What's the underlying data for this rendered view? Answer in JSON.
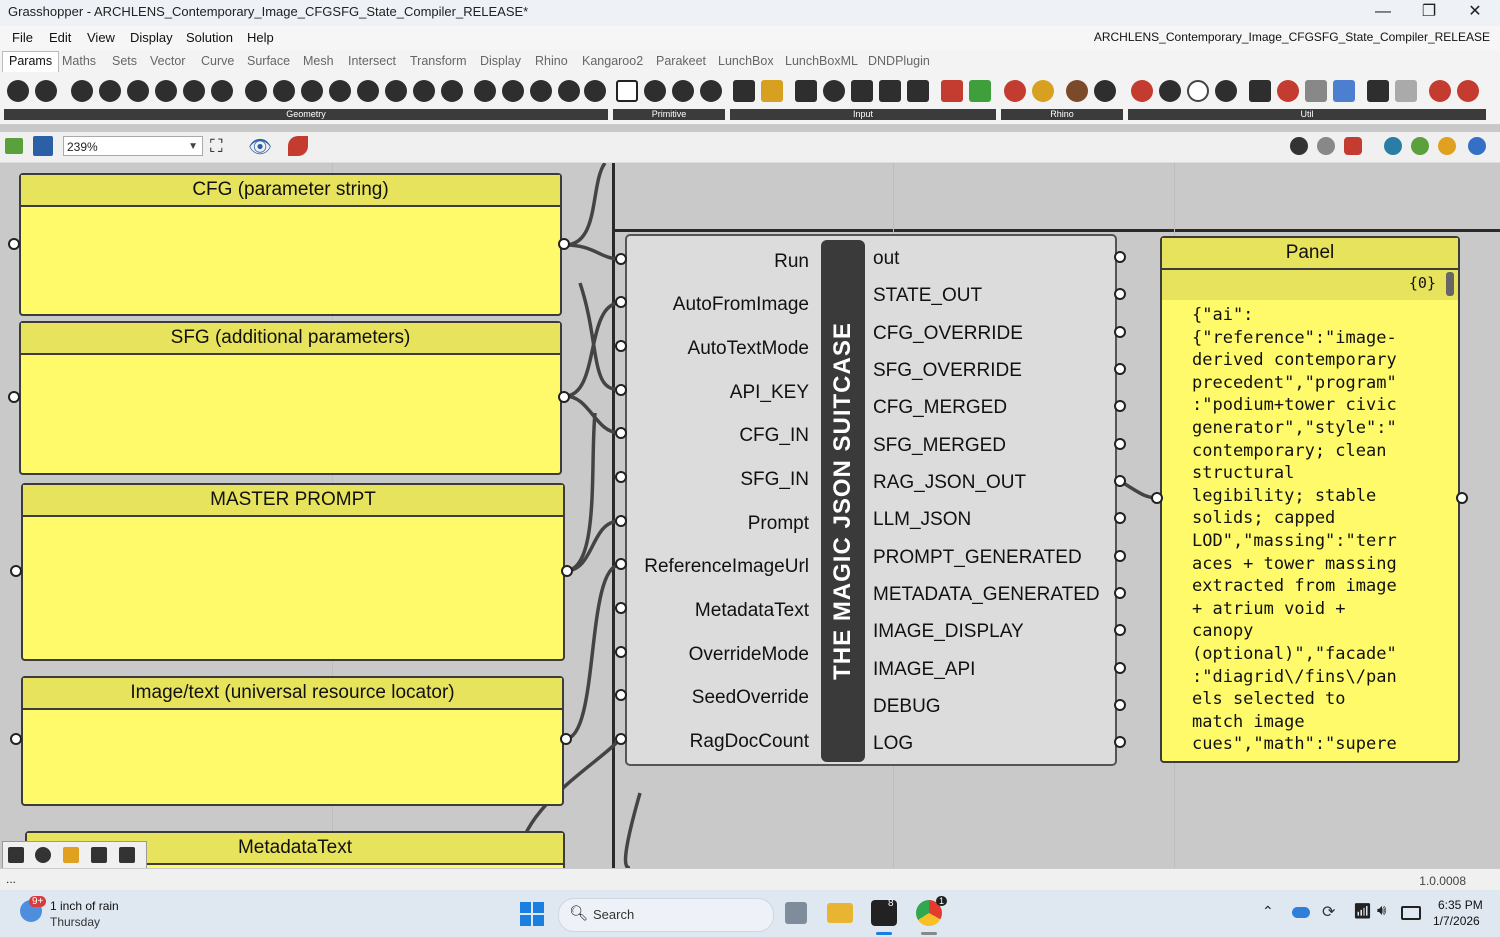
{
  "window": {
    "title": "Grasshopper - ARCHLENS_Contemporary_Image_CFGSFG_State_Compiler_RELEASE*",
    "minimize": "—",
    "maximize": "❐",
    "close": "✕"
  },
  "menu": {
    "items": [
      "File",
      "Edit",
      "View",
      "Display",
      "Solution",
      "Help"
    ],
    "document_name": "ARCHLENS_Contemporary_Image_CFGSFG_State_Compiler_RELEASE"
  },
  "tabs": [
    "Params",
    "Maths",
    "Sets",
    "Vector",
    "Curve",
    "Surface",
    "Mesh",
    "Intersect",
    "Transform",
    "Display",
    "Rhino",
    "Kangaroo2",
    "Parakeet",
    "LunchBox",
    "LunchBoxML",
    "DNDPlugin"
  ],
  "ribbon": {
    "groups": [
      "Geometry",
      "Primitive",
      "Input",
      "Rhino",
      "Util"
    ]
  },
  "canvas_toolbar": {
    "zoom": "239%"
  },
  "panels": {
    "cfg": "CFG (parameter string)",
    "sfg": "SFG (additional parameters)",
    "master": "MASTER PROMPT",
    "image_url": "Image/text (universal resource locator)",
    "metadata": "MetadataText"
  },
  "component": {
    "name": "THE MAGIC JSON SUITCASE",
    "inputs": [
      "Run",
      "AutoFromImage",
      "AutoTextMode",
      "API_KEY",
      "CFG_IN",
      "SFG_IN",
      "Prompt",
      "ReferenceImageUrl",
      "MetadataText",
      "OverrideMode",
      "SeedOverride",
      "RagDocCount"
    ],
    "outputs": [
      "out",
      "STATE_OUT",
      "CFG_OVERRIDE",
      "SFG_OVERRIDE",
      "CFG_MERGED",
      "SFG_MERGED",
      "RAG_JSON_OUT",
      "LLM_JSON",
      "PROMPT_GENERATED",
      "METADATA_GENERATED",
      "IMAGE_DISPLAY",
      "IMAGE_API",
      "DEBUG",
      "LOG"
    ]
  },
  "output_panel": {
    "title": "Panel",
    "path": "{0}",
    "content": "{\"ai\":\n{\"reference\":\"image-\nderived contemporary\nprecedent\",\"program\"\n:\"podium+tower civic\ngenerator\",\"style\":\"\ncontemporary; clean\nstructural\nlegibility; stable\nsolids; capped\nLOD\",\"massing\":\"terr\naces + tower massing\nextracted from image\n+ atrium void +\ncanopy\n(optional)\",\"facade\"\n:\"diagrid\\/fins\\/pan\nels selected to\nmatch image\ncues\",\"math\":\"supere\nllipse\""
  },
  "statusbar": {
    "left": "...",
    "version": "1.0.0008"
  },
  "taskbar": {
    "weather_badge": "9+",
    "weather_main": "1 inch of rain",
    "weather_day": "Thursday",
    "search": "Search",
    "rhino_badge": "8",
    "chrome_badge": "1",
    "time": "6:35 PM",
    "date": "1/7/2026"
  }
}
